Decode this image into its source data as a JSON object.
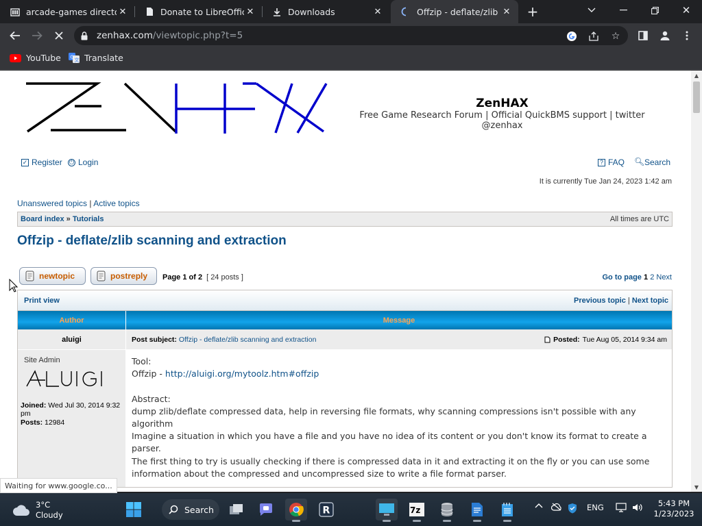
{
  "browser": {
    "tabs": [
      {
        "title": "arcade-games directory",
        "icon": "folder-icon"
      },
      {
        "title": "Donate to LibreOffice |",
        "icon": "page-icon"
      },
      {
        "title": "Downloads",
        "icon": "download-icon"
      },
      {
        "title": "Offzip - deflate/zlib sca",
        "icon": "loading-spinner-icon",
        "active": true
      }
    ],
    "url_domain": "zenhax.com",
    "url_path": "/viewtopic.php?t=5",
    "bookmarks": [
      {
        "label": "YouTube",
        "icon": "youtube-icon"
      },
      {
        "label": "Translate",
        "icon": "translate-icon"
      }
    ],
    "status_text": "Waiting for www.google.co..."
  },
  "site": {
    "name": "ZenHAX",
    "description": "Free Game Research Forum | Official QuickBMS support | twitter @zenhax",
    "register_label": "Register",
    "login_label": "Login",
    "faq_label": "FAQ",
    "search_label": "Search",
    "current_time": "It is currently Tue Jan 24, 2023 1:42 am",
    "unanswered_label": "Unanswered topics",
    "active_label": "Active topics",
    "quicklink_sep": "|",
    "breadcrumb_index": "Board index",
    "breadcrumb_sep": "»",
    "breadcrumb_forum": "Tutorials",
    "timezone": "All times are UTC"
  },
  "topic": {
    "title": "Offzip - deflate/zlib scanning and extraction",
    "new_topic_w1": "new",
    "new_topic_w2": "topic",
    "post_reply_w1": "post",
    "post_reply_w2": "reply",
    "page_label": "Page 1 of 2",
    "post_count": "[ 24 posts ]",
    "goto_label": "Go to page",
    "goto_current": "1",
    "goto_other": "2",
    "goto_next": "Next",
    "print_view": "Print view",
    "previous_topic": "Previous topic",
    "next_topic": "Next topic",
    "topic_nav_sep": "|",
    "col_author": "Author",
    "col_message": "Message"
  },
  "post": {
    "author": "aluigi",
    "subject_label": "Post subject:",
    "subject": "Offzip - deflate/zlib scanning and extraction",
    "posted_label": "Posted:",
    "posted_date": "Tue Aug 05, 2014 9:34 am",
    "rank": "Site Admin",
    "signature_text": "ALUIGI",
    "joined_label": "Joined:",
    "joined_date": "Wed Jul 30, 2014 9:32 pm",
    "posts_label": "Posts:",
    "posts_count": "12984",
    "body": {
      "tool_label": "Tool:",
      "tool_name": "Offzip - ",
      "tool_link": "http://aluigi.org/mytoolz.htm#offzip",
      "abstract_label": "Abstract:",
      "abstract_text": "dump zlib/deflate compressed data, help in reversing file formats, why scanning compressions isn't possible with any algorithm",
      "para1": "Imagine a situation in which you have a file and you have no idea of its content or you don't know its format to create a parser.",
      "para2_line1": "The first thing to try is usually checking if there is compressed data in it and extracting it on the fly or you can use some",
      "para2_line2": "information about the compressed and uncompressed size to write a file format parser."
    }
  },
  "taskbar": {
    "temperature": "3°C",
    "condition": "Cloudy",
    "search_label": "Search",
    "language": "ENG",
    "time": "5:43 PM",
    "date": "1/23/2023",
    "apps": [
      "windows-start-icon",
      "task-view-icon",
      "teams-chat-icon",
      "chrome-icon",
      "r-app-icon",
      "monitor-app-icon",
      "7zip-icon",
      "database-icon",
      "word-doc-icon",
      "notepad-icon"
    ]
  },
  "colors": {
    "link": "#105289",
    "header_bar": "#12a3eb",
    "header_text": "#ffa34f",
    "chrome_dark": "#202124",
    "chrome_toolbar": "#35363a"
  }
}
